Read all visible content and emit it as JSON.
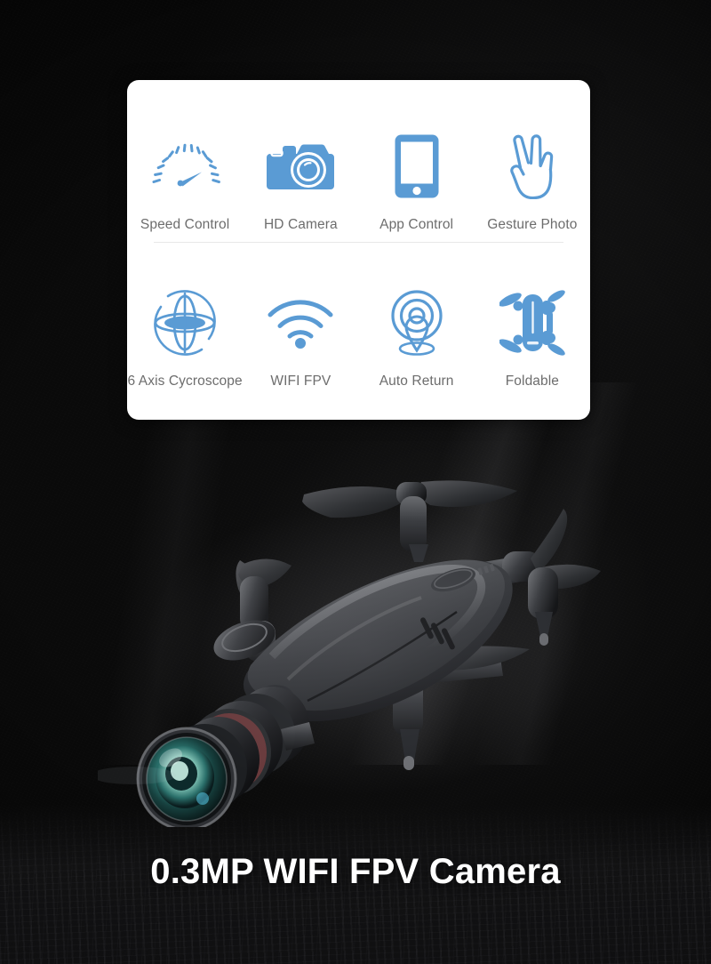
{
  "page": {
    "background_color": "#0a0a0a",
    "accent_color": "#5a9bd4",
    "label_color": "#6d6d6d",
    "caption_color": "#ffffff"
  },
  "feature_card": {
    "background_color": "#ffffff",
    "rows": [
      {
        "features": [
          {
            "label": "Speed Control",
            "icon": "speedometer-icon"
          },
          {
            "label": "HD Camera",
            "icon": "camera-icon"
          },
          {
            "label": "App Control",
            "icon": "smartphone-icon"
          },
          {
            "label": "Gesture Photo",
            "icon": "hand-gesture-icon"
          }
        ]
      },
      {
        "features": [
          {
            "label": "6 Axis Cycroscope",
            "icon": "gyroscope-icon"
          },
          {
            "label": "WIFI FPV",
            "icon": "wifi-icon"
          },
          {
            "label": "Auto Return",
            "icon": "location-pin-icon"
          },
          {
            "label": "Foldable",
            "icon": "foldable-drone-icon"
          }
        ]
      }
    ]
  },
  "product": {
    "image": "foldable-quadcopter-drone-with-camera-lens",
    "caption": "0.3MP WIFI FPV Camera"
  }
}
